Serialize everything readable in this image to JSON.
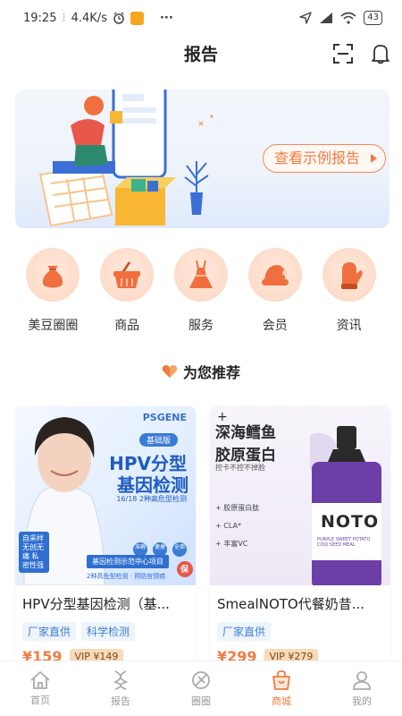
{
  "status_bar": {
    "time": "19:25",
    "net_speed": "4.4K/s",
    "dots": "···",
    "battery": "43"
  },
  "header": {
    "title": "报告"
  },
  "banner": {
    "cta_label": "查看示例报告"
  },
  "categories": [
    {
      "label": "美豆圈圈",
      "icon": "bag-icon"
    },
    {
      "label": "商品",
      "icon": "basket-icon"
    },
    {
      "label": "服务",
      "icon": "dress-icon"
    },
    {
      "label": "会员",
      "icon": "hat-icon"
    },
    {
      "label": "资讯",
      "icon": "mitten-icon"
    }
  ],
  "recommend": {
    "title": "为您推荐"
  },
  "products": [
    {
      "name": "HPV分型基因检测（基...",
      "tags": [
        "厂家直供",
        "科学检测"
      ],
      "price": "¥159",
      "vip": "VIP ¥149",
      "image": {
        "brand": "PSGENE",
        "badge": "基础版",
        "title_1": "HPV分型",
        "title_2": "基因检测",
        "subtitle": "16/18 2种高危型检测",
        "features": [
          "准确",
          "便捷",
          "全面"
        ],
        "center_label": "基因检测示范中心项目",
        "line_2": "2种高危型检测 · 预防宫颈癌",
        "stamp": "自采样 无创无痛 私密性强",
        "seal": "保"
      }
    },
    {
      "name": "SmealNOTO代餐奶昔...",
      "tags": [
        "厂家直供"
      ],
      "price": "¥299",
      "vip": "VIP ¥279",
      "image": {
        "title_1": "深海鳕鱼",
        "title_2": "胶原蛋白",
        "subtitle": "控卡不控不掉脸",
        "list": [
          "+ 胶原蛋白肽",
          "+ CLA*",
          "+ 丰富VC"
        ],
        "logo": "NOTO",
        "flavor": "PURPLE SWEET POTATO COIX SEED MEAL"
      }
    }
  ],
  "tabbar": [
    {
      "label": "首页",
      "icon": "home-icon",
      "active": false
    },
    {
      "label": "报告",
      "icon": "report-icon",
      "active": false
    },
    {
      "label": "圈圈",
      "icon": "circle-icon",
      "active": false
    },
    {
      "label": "商城",
      "icon": "shop-icon",
      "active": true
    },
    {
      "label": "我的",
      "icon": "user-icon",
      "active": false
    }
  ],
  "colors": {
    "accent": "#f07b43",
    "tag_text": "#3d7fd4",
    "tag_bg": "#eef4fb",
    "category_bg": "#fcd6c2"
  }
}
